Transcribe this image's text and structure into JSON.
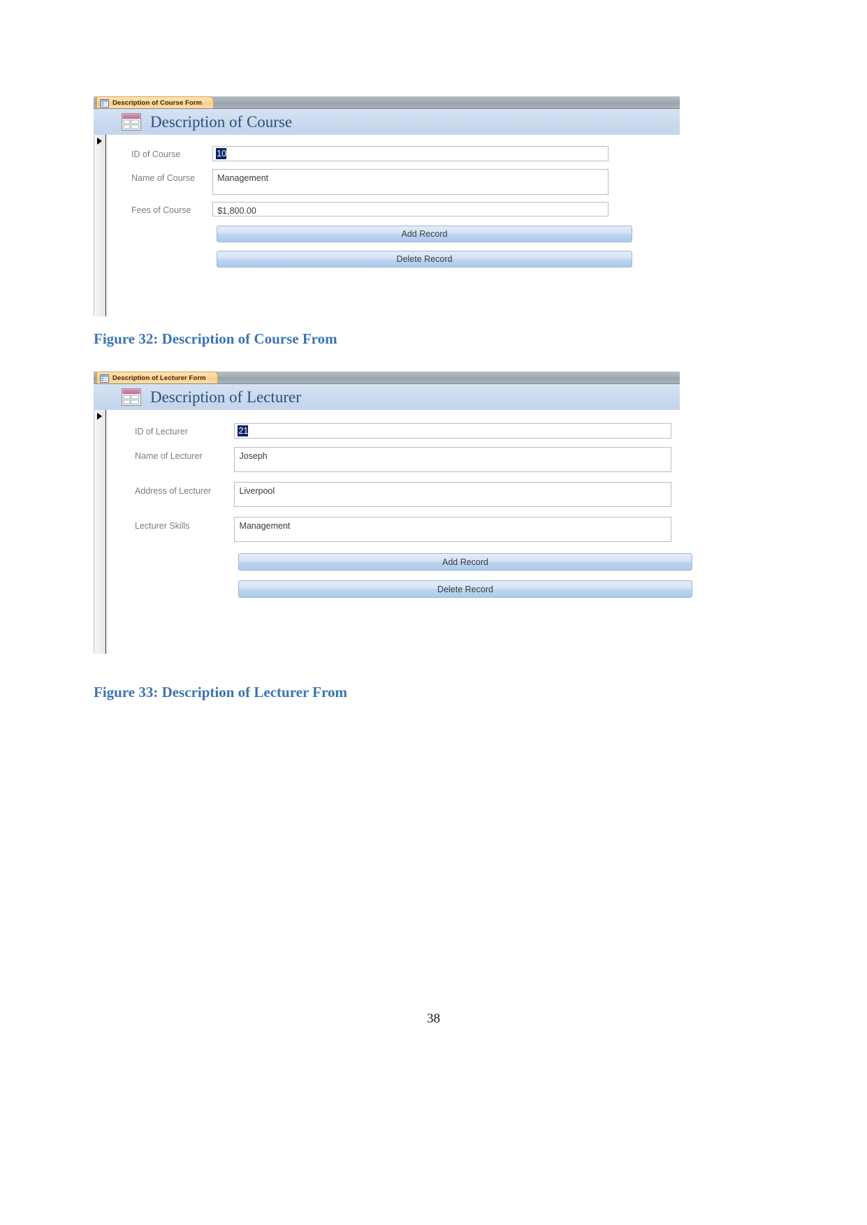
{
  "page": {
    "number": "38"
  },
  "figures": [
    {
      "caption": "Figure 32: Description of Course From",
      "window": {
        "tab_label": "Description of Course Form",
        "tab_icon": "form-icon",
        "header_icon": "form-icon",
        "header_title": "Description of Course",
        "record_selector_icon": "record-selector-arrow-icon",
        "fields": [
          {
            "label": "ID of Course",
            "value": "10",
            "selected": true
          },
          {
            "label": "Name of Course",
            "value": "Management",
            "selected": false
          },
          {
            "label": "Fees of Course",
            "value": "$1,800.00",
            "selected": false
          }
        ],
        "buttons": [
          {
            "label": "Add Record"
          },
          {
            "label": "Delete Record"
          }
        ]
      }
    },
    {
      "caption": "Figure 33: Description of Lecturer From",
      "window": {
        "tab_label": "Description of Lecturer Form",
        "tab_icon": "form-icon",
        "header_icon": "form-icon",
        "header_title": "Description of Lecturer",
        "record_selector_icon": "record-selector-arrow-icon",
        "fields": [
          {
            "label": "ID of Lecturer",
            "value": "21",
            "selected": true
          },
          {
            "label": "Name of Lecturer",
            "value": "Joseph",
            "selected": false
          },
          {
            "label": "Address of Lecturer",
            "value": "Liverpool",
            "selected": false
          },
          {
            "label": "Lecturer Skills",
            "value": "Management",
            "selected": false
          }
        ],
        "buttons": [
          {
            "label": "Add Record"
          },
          {
            "label": "Delete Record"
          }
        ]
      }
    }
  ],
  "colors": {
    "tab_strip": "#a3abb3",
    "tab_active": "#fcd69a",
    "header_band": "#c9d9ee",
    "header_title": "#2f4f7f",
    "caption": "#3b74b4",
    "button": "#bcd4ef",
    "selection": "#0a246a"
  }
}
